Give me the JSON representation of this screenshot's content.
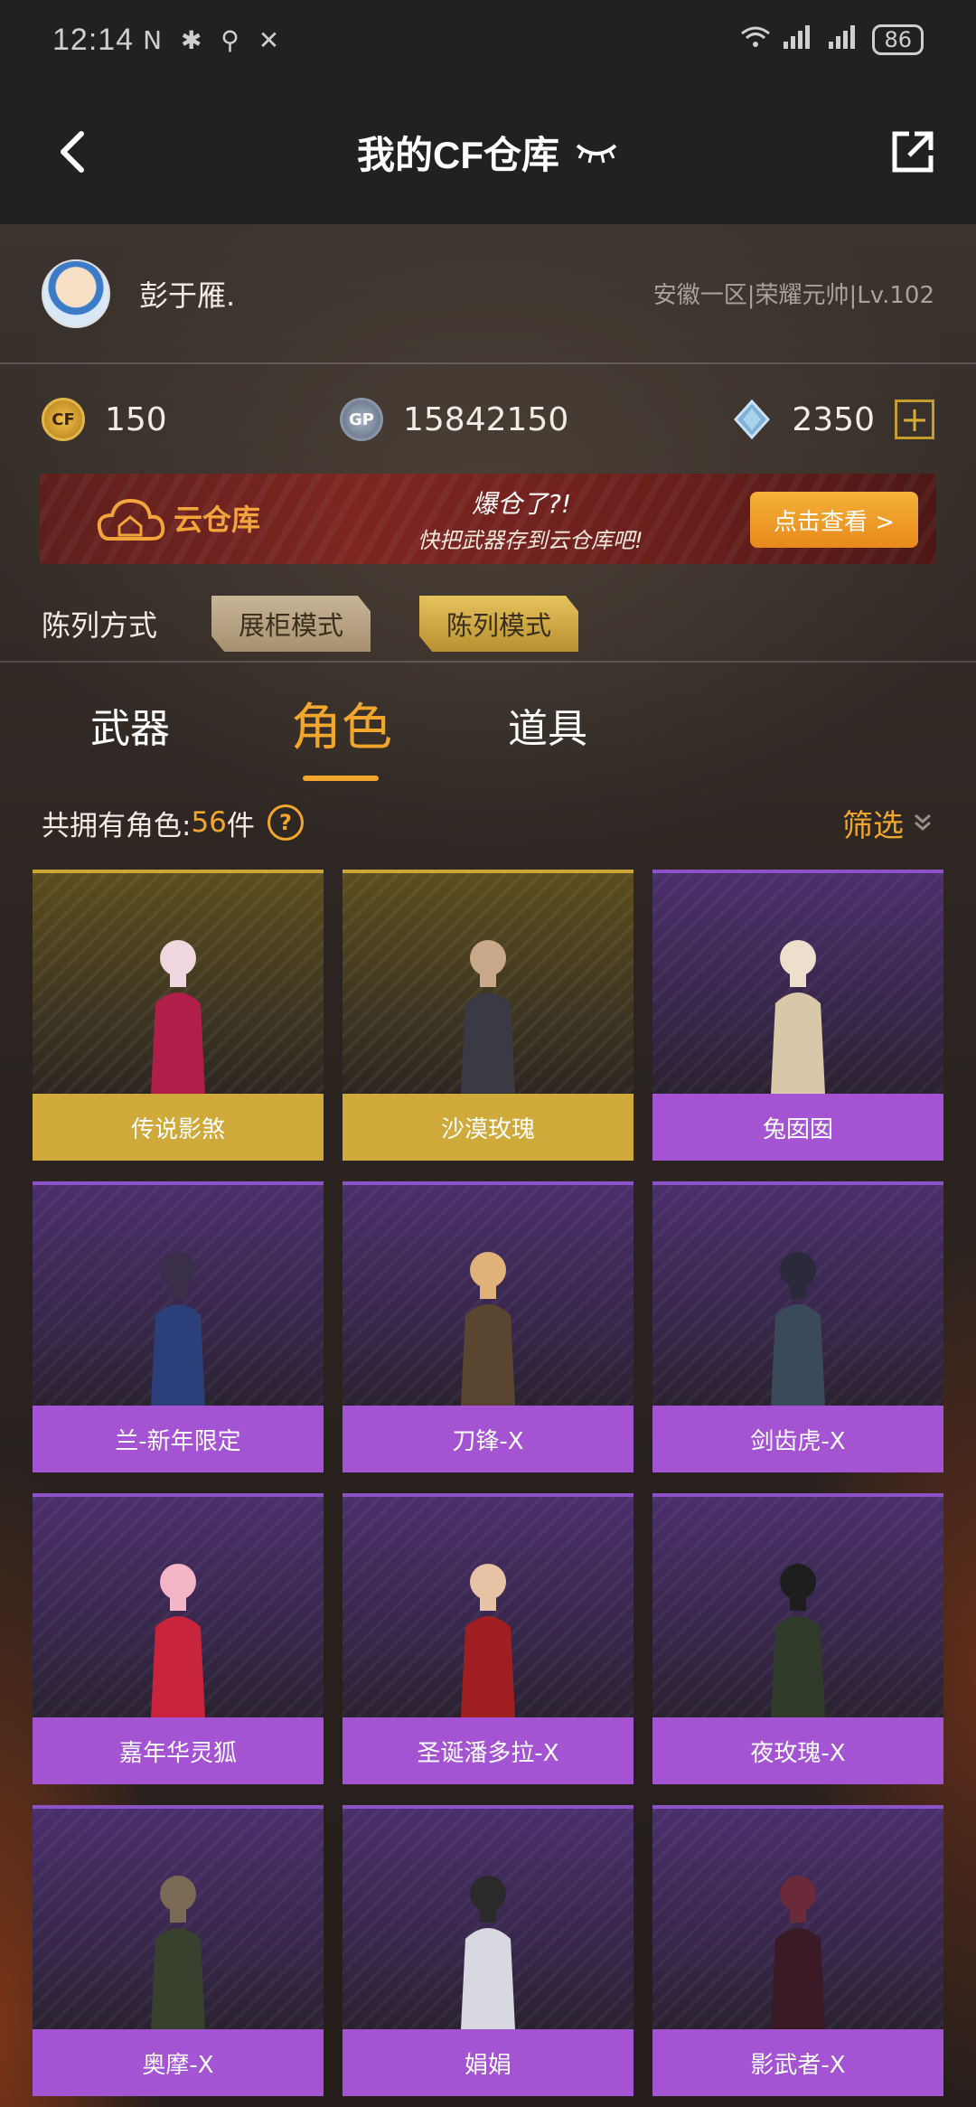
{
  "status_bar": {
    "time": "12:14",
    "battery": "86"
  },
  "header": {
    "title": "我的CF仓库"
  },
  "user": {
    "name": "彭于雁.",
    "server_info": "安徽一区|荣耀元帅|Lv.102"
  },
  "currency": {
    "cf_points": "150",
    "gp": "15842150",
    "diamonds": "2350",
    "cf_coin_label": "CF",
    "gp_coin_label": "GP"
  },
  "banner": {
    "title": "云仓库",
    "line1": "爆仓了?!",
    "line2": "快把武器存到云仓库吧!",
    "button": "点击查看 >"
  },
  "display_mode": {
    "label": "陈列方式",
    "showcase": "展柜模式",
    "list": "陈列模式"
  },
  "tabs": [
    {
      "label": "武器"
    },
    {
      "label": "角色"
    },
    {
      "label": "道具"
    }
  ],
  "count": {
    "label": "共拥有角色:",
    "number": "56",
    "unit": "件",
    "help": "?"
  },
  "filter": {
    "label": "筛选"
  },
  "colors": {
    "accent": "#f2a72c",
    "gold_card": "#cfaa3a",
    "purple_card": "#a454d3"
  },
  "characters": [
    {
      "name": "传说影煞",
      "rarity": "gold"
    },
    {
      "name": "沙漠玫瑰",
      "rarity": "gold"
    },
    {
      "name": "兔囡囡",
      "rarity": "purple"
    },
    {
      "name": "兰-新年限定",
      "rarity": "purple"
    },
    {
      "name": "刀锋-X",
      "rarity": "purple"
    },
    {
      "name": "剑齿虎-X",
      "rarity": "purple"
    },
    {
      "name": "嘉年华灵狐",
      "rarity": "purple"
    },
    {
      "name": "圣诞潘多拉-X",
      "rarity": "purple"
    },
    {
      "name": "夜玫瑰-X",
      "rarity": "purple"
    },
    {
      "name": "奥摩-X",
      "rarity": "purple"
    },
    {
      "name": "娟娟",
      "rarity": "purple"
    },
    {
      "name": "影武者-X",
      "rarity": "purple"
    }
  ]
}
